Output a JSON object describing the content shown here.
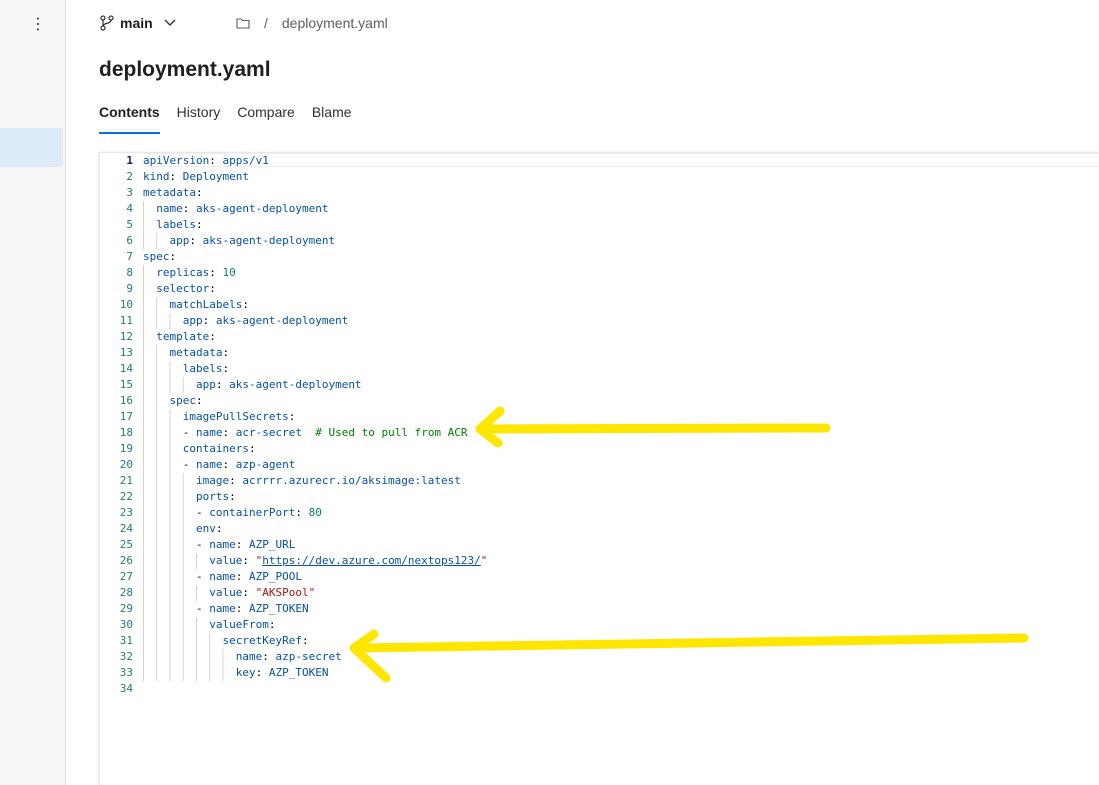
{
  "header": {
    "branch": "main",
    "breadcrumb_separator": "/",
    "file_name": "deployment.yaml"
  },
  "page_title": "deployment.yaml",
  "tabs": [
    {
      "label": "Contents",
      "active": true
    },
    {
      "label": "History",
      "active": false
    },
    {
      "label": "Compare",
      "active": false
    },
    {
      "label": "Blame",
      "active": false
    }
  ],
  "icons": {
    "rail_more": "more-vertical-icon",
    "branch": "branch-icon",
    "chevron": "chevron-down-icon",
    "folder": "folder-icon"
  },
  "colors": {
    "accent": "#0078d4",
    "selected_rail": "#deecf9",
    "arrow": "#ffe600"
  },
  "code_lines": [
    "apiVersion: apps/v1",
    "kind: Deployment",
    "metadata:",
    "  name: aks-agent-deployment",
    "  labels:",
    "    app: aks-agent-deployment",
    "spec:",
    "  replicas: 10",
    "  selector:",
    "    matchLabels:",
    "      app: aks-agent-deployment",
    "  template:",
    "    metadata:",
    "      labels:",
    "        app: aks-agent-deployment",
    "    spec:",
    "      imagePullSecrets:",
    "      - name: acr-secret  # Used to pull from ACR",
    "      containers:",
    "      - name: azp-agent",
    "        image: acrrrr.azurecr.io/aksimage:latest",
    "        ports:",
    "        - containerPort: 80",
    "        env:",
    "        - name: AZP_URL",
    "          value: \"https://dev.azure.com/nextops123/\"",
    "        - name: AZP_POOL",
    "          value: \"AKSPool\"",
    "        - name: AZP_TOKEN",
    "          valueFrom:",
    "            secretKeyRef:",
    "              name: azp-secret",
    "              key: AZP_TOKEN",
    ""
  ]
}
